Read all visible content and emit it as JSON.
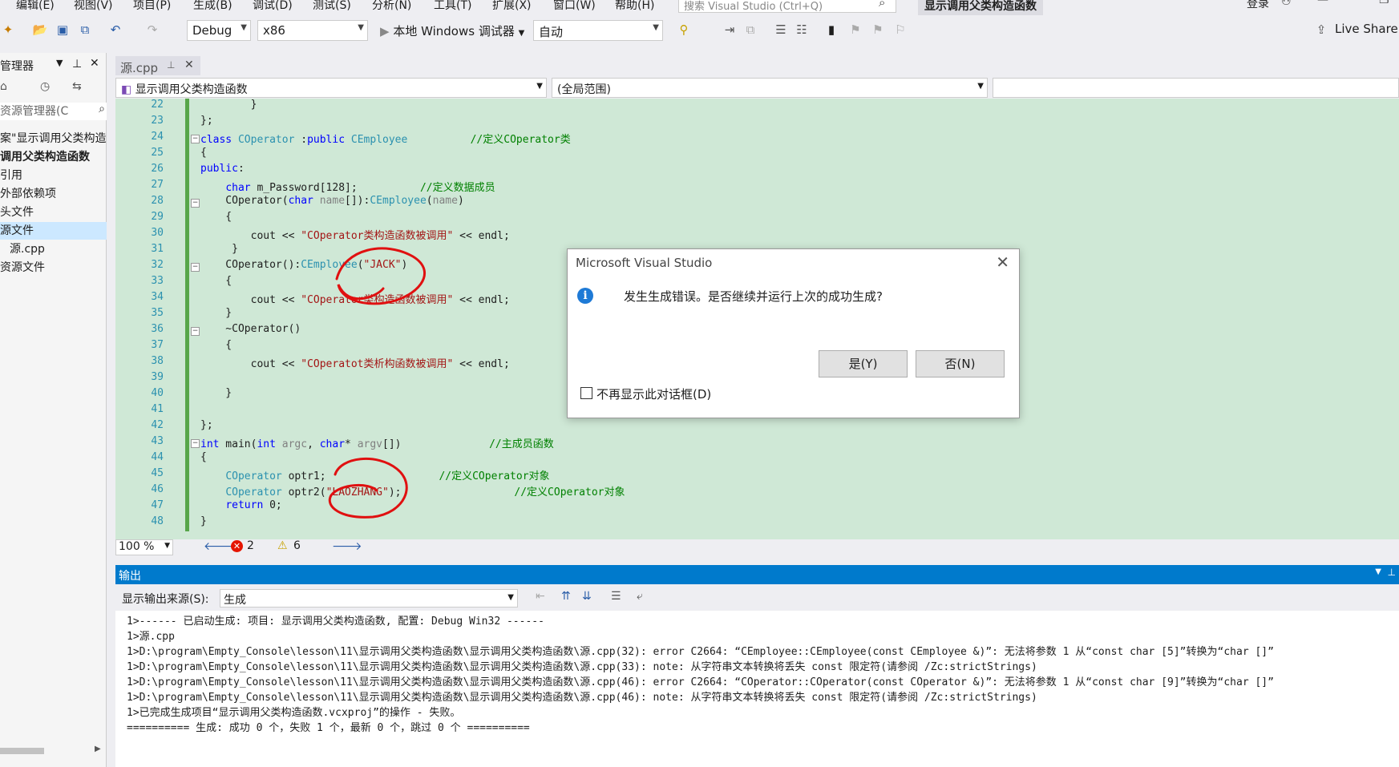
{
  "menubar": {
    "items": [
      "编辑(E)",
      "视图(V)",
      "项目(P)",
      "生成(B)",
      "调试(D)",
      "测试(S)",
      "分析(N)",
      "工具(T)",
      "扩展(X)",
      "窗口(W)",
      "帮助(H)"
    ],
    "search_placeholder": "搜索 Visual Studio (Ctrl+Q)",
    "title": "显示调用父类构造函数",
    "login": "登录"
  },
  "toolbar": {
    "config": "Debug",
    "platform": "x86",
    "run_label": "本地 Windows 调试器",
    "mode": "自动",
    "live_share": "Live Share"
  },
  "left_panel": {
    "header": "管理器",
    "search_placeholder": "资源管理器(C",
    "items": [
      {
        "label": "案\"显示调用父类构造函",
        "selected": false
      },
      {
        "label": "调用父类构造函数",
        "selected": false,
        "bold": true
      },
      {
        "label": "引用",
        "selected": false
      },
      {
        "label": "外部依赖项",
        "selected": false
      },
      {
        "label": "头文件",
        "selected": false
      },
      {
        "label": "源文件",
        "selected": true
      },
      {
        "label": "源.cpp",
        "selected": false
      },
      {
        "label": "资源文件",
        "selected": false
      }
    ]
  },
  "doc_tab": {
    "label": "源.cpp"
  },
  "navbar": {
    "scope_left": "显示调用父类构造函数",
    "scope_middle": "(全局范围)"
  },
  "editor": {
    "line_numbers": [
      "22",
      "23",
      "24",
      "25",
      "26",
      "27",
      "28",
      "29",
      "30",
      "31",
      "32",
      "33",
      "34",
      "35",
      "36",
      "37",
      "38",
      "39",
      "40",
      "41",
      "42",
      "43",
      "44",
      "45",
      "46",
      "47",
      "48"
    ],
    "zoom": "100 %",
    "errors": "2",
    "warnings": "6"
  },
  "output": {
    "title": "输出",
    "source_label": "显示输出来源(S):",
    "source_value": "生成",
    "lines": [
      "1>------ 已启动生成: 项目: 显示调用父类构造函数, 配置: Debug Win32 ------",
      "1>源.cpp",
      "1>D:\\program\\Empty_Console\\lesson\\11\\显示调用父类构造函数\\显示调用父类构造函数\\源.cpp(32): error C2664: “CEmployee::CEmployee(const CEmployee &)”: 无法将参数 1 从“const char [5]”转换为“char []”",
      "1>D:\\program\\Empty_Console\\lesson\\11\\显示调用父类构造函数\\显示调用父类构造函数\\源.cpp(33): note: 从字符串文本转换将丢失 const 限定符(请参阅 /Zc:strictStrings)",
      "1>D:\\program\\Empty_Console\\lesson\\11\\显示调用父类构造函数\\显示调用父类构造函数\\源.cpp(46): error C2664: “COperator::COperator(const COperator &)”: 无法将参数 1 从“const char [9]”转换为“char []”",
      "1>D:\\program\\Empty_Console\\lesson\\11\\显示调用父类构造函数\\显示调用父类构造函数\\源.cpp(46): note: 从字符串文本转换将丢失 const 限定符(请参阅 /Zc:strictStrings)",
      "1>已完成生成项目“显示调用父类构造函数.vcxproj”的操作 - 失败。",
      "========== 生成: 成功 0 个，失败 1 个，最新 0 个，跳过 0 个 =========="
    ]
  },
  "dialog": {
    "title": "Microsoft Visual Studio",
    "message": "发生生成错误。是否继续并运行上次的成功生成?",
    "yes_label": "是(Y)",
    "no_label": "否(N)",
    "checkbox_label": "不再显示此对话框(D)"
  },
  "colors": {
    "accent": "#007acc",
    "editor_bg": "#cfe8d6",
    "annotation": "#e01010"
  }
}
